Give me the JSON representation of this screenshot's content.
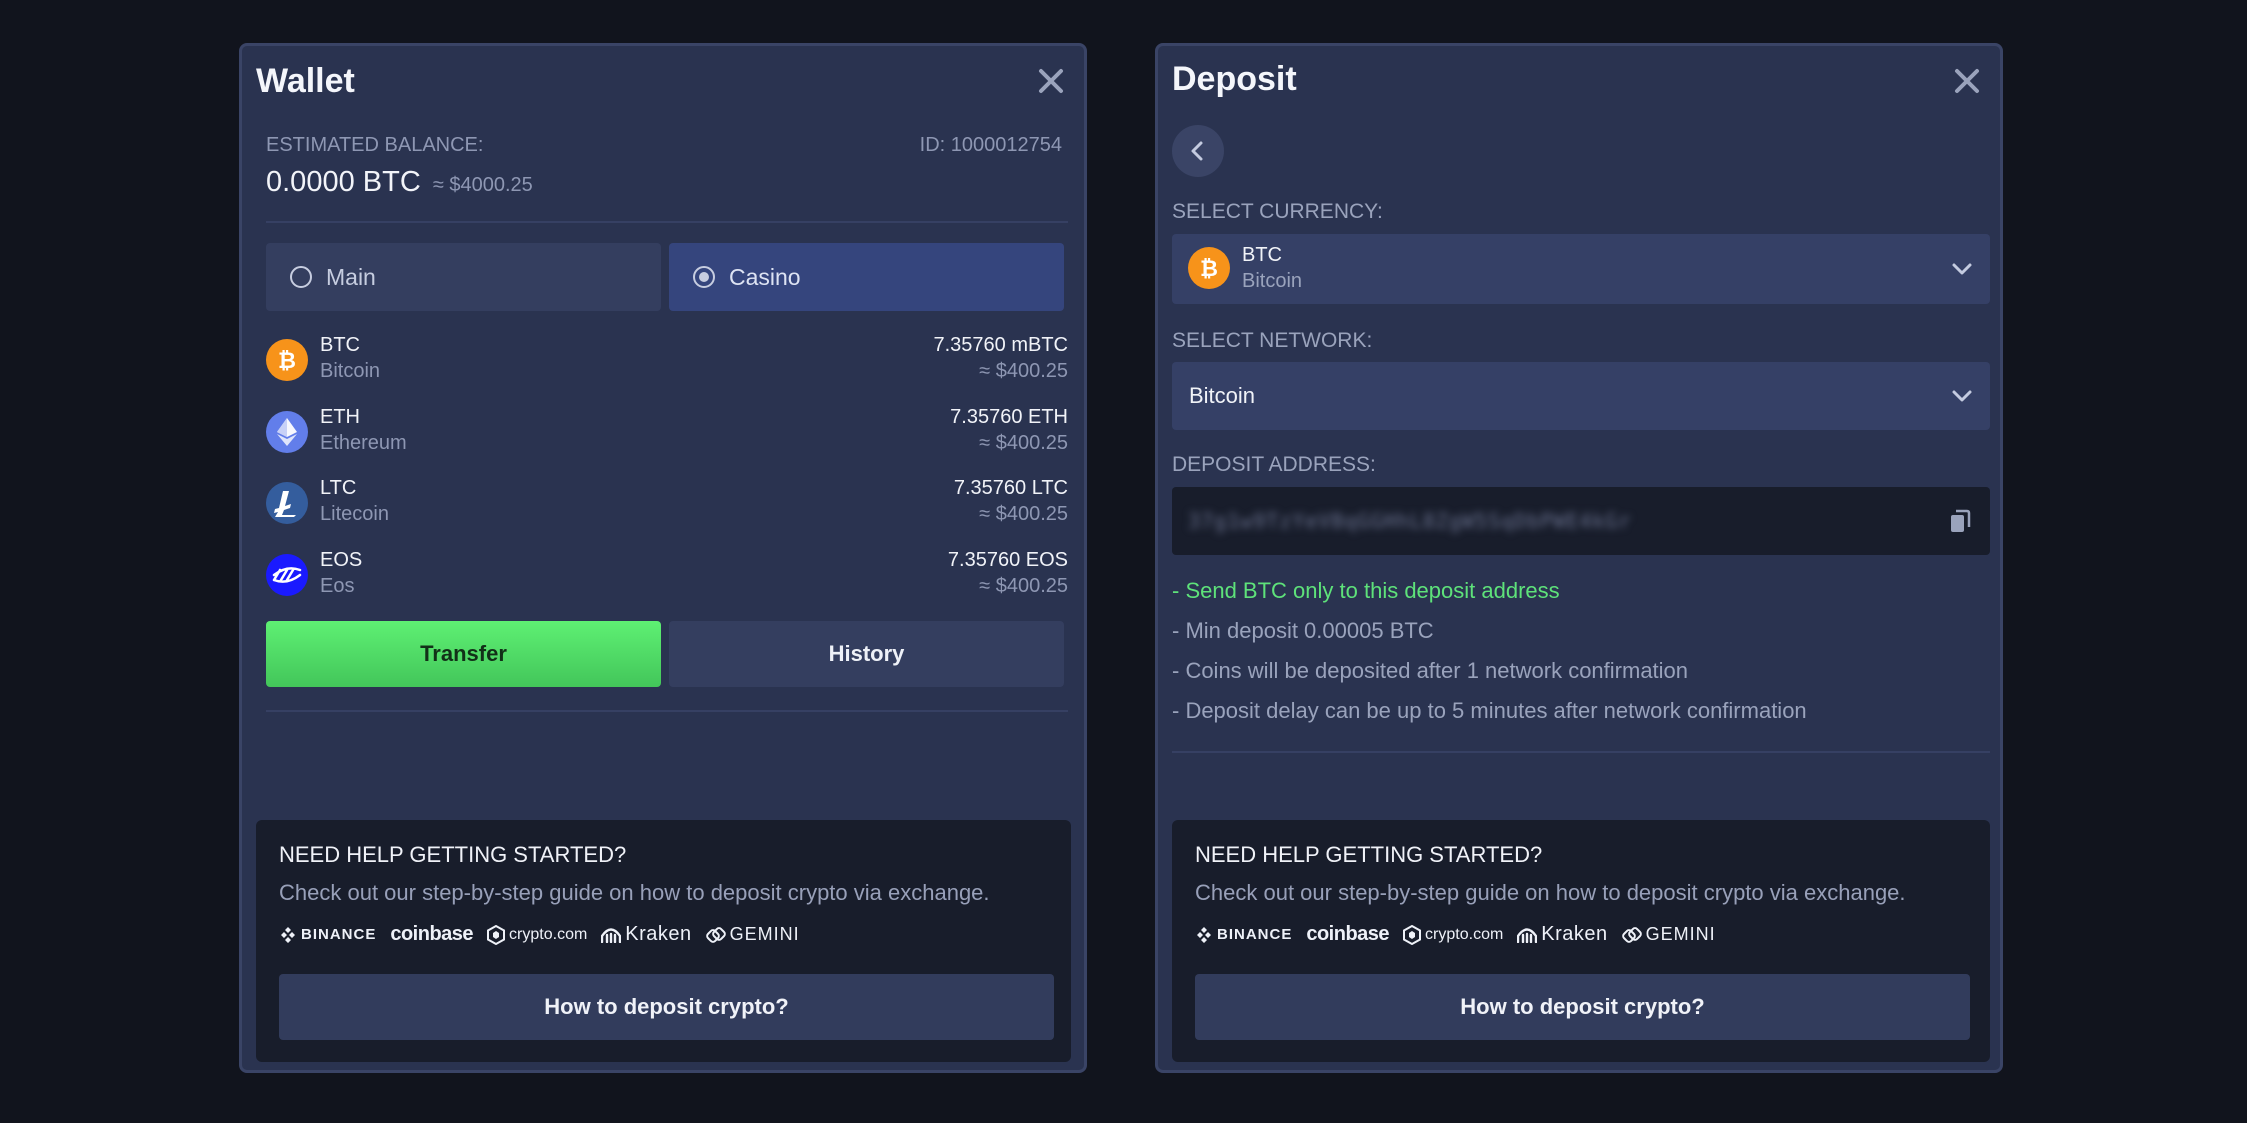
{
  "wallet": {
    "title": "Wallet",
    "balance_label": "ESTIMATED BALANCE:",
    "id_label": "ID: 1000012754",
    "balance_value": "0.0000 BTC",
    "balance_fiat": "≈ $4000.25",
    "toggle_main": "Main",
    "toggle_casino": "Casino",
    "selected_toggle": "Casino",
    "coins": [
      {
        "symbol": "BTC",
        "name": "Bitcoin",
        "amount": "7.35760 mBTC",
        "fiat": "≈ $400.25",
        "icon": "bitcoin-icon",
        "color": "#f7931a"
      },
      {
        "symbol": "ETH",
        "name": "Ethereum",
        "amount": "7.35760 ETH",
        "fiat": "≈ $400.25",
        "icon": "ethereum-icon",
        "color": "#627eea"
      },
      {
        "symbol": "LTC",
        "name": "Litecoin",
        "amount": "7.35760 LTC",
        "fiat": "≈ $400.25",
        "icon": "litecoin-icon",
        "color": "#345d9d"
      },
      {
        "symbol": "EOS",
        "name": "Eos",
        "amount": "7.35760 EOS",
        "fiat": "≈ $400.25",
        "icon": "eos-icon",
        "color": "#1a1aff"
      }
    ],
    "transfer_label": "Transfer",
    "history_label": "History"
  },
  "deposit": {
    "title": "Deposit",
    "currency_label": "SELECT CURRENCY:",
    "currency_symbol": "BTC",
    "currency_name": "Bitcoin",
    "network_label": "SELECT NETWORK:",
    "network_value": "Bitcoin",
    "address_label": "DEPOSIT ADDRESS:",
    "address_value": "37g1w9TzYeVBqGGHhL8ZgW5SqDbPWE4kGr",
    "notes": [
      "- Send BTC only to this deposit address",
      "- Min deposit 0.00005 BTC",
      "- Coins will be deposited after 1 network confirmation",
      "- Deposit delay can be up to 5 minutes after network confirmation"
    ]
  },
  "help": {
    "title": "NEED HELP GETTING STARTED?",
    "description": "Check out our step-by-step guide on how to deposit crypto via exchange.",
    "logos": [
      "BINANCE",
      "coinbase",
      "crypto.com",
      "Kraken",
      "GEMINI"
    ],
    "button_label": "How to deposit crypto?"
  },
  "colors": {
    "accent_green": "#4fd868",
    "panel_bg": "#2a3350",
    "page_bg": "#11141d"
  }
}
